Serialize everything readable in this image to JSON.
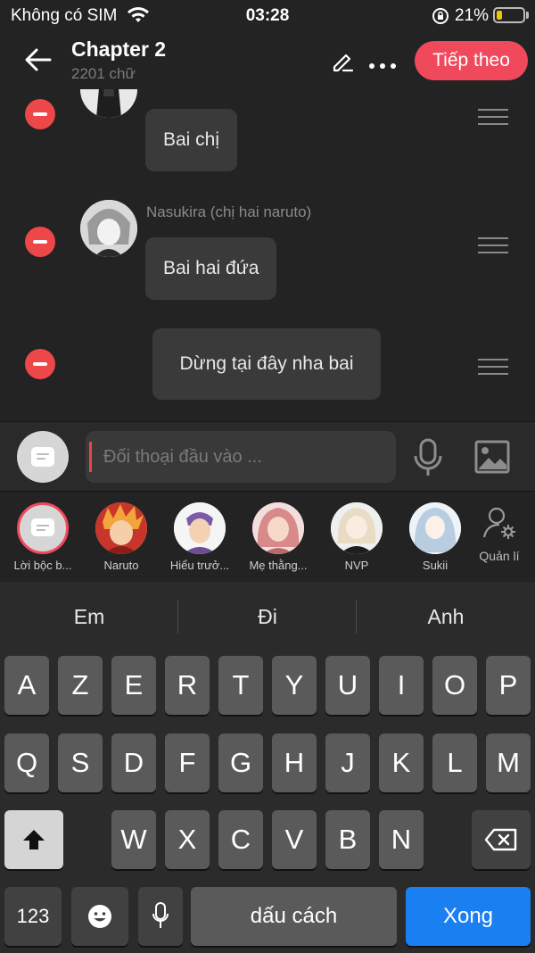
{
  "status_bar": {
    "carrier": "Không có SIM",
    "time": "03:28",
    "battery_percent": "21%",
    "battery_level": 0.21
  },
  "header": {
    "title": "Chapter 2",
    "subtitle": "2201 chữ",
    "next_label": "Tiếp theo"
  },
  "chat": {
    "messages": [
      {
        "speaker": "",
        "text": "Bai chị"
      },
      {
        "speaker": "Nasukira (chị hai naruto)",
        "text": "Bai hai đứa"
      },
      {
        "speaker": "",
        "text": "Dừng tại đây nha bai"
      }
    ]
  },
  "composer": {
    "placeholder": "Đối thoại đầu vào ..."
  },
  "characters": [
    {
      "label": "Lời bộc b..."
    },
    {
      "label": "Naruto"
    },
    {
      "label": "Hiểu trưở..."
    },
    {
      "label": "Mẹ thằng..."
    },
    {
      "label": "NVP"
    },
    {
      "label": "Sukii"
    }
  ],
  "manage_label": "Quản lí",
  "keyboard": {
    "suggestions": [
      "Em",
      "Đi",
      "Anh"
    ],
    "row1": [
      "A",
      "Z",
      "E",
      "R",
      "T",
      "Y",
      "U",
      "I",
      "O",
      "P"
    ],
    "row2": [
      "Q",
      "S",
      "D",
      "F",
      "G",
      "H",
      "J",
      "K",
      "L",
      "M"
    ],
    "row3": [
      "W",
      "X",
      "C",
      "V",
      "B",
      "N"
    ],
    "numbers_key": "123",
    "space_key": "dấu cách",
    "done_key": "Xong"
  },
  "colors": {
    "accent": "#f0495c",
    "delete": "#ee4749",
    "done_key": "#1a7ff0"
  }
}
